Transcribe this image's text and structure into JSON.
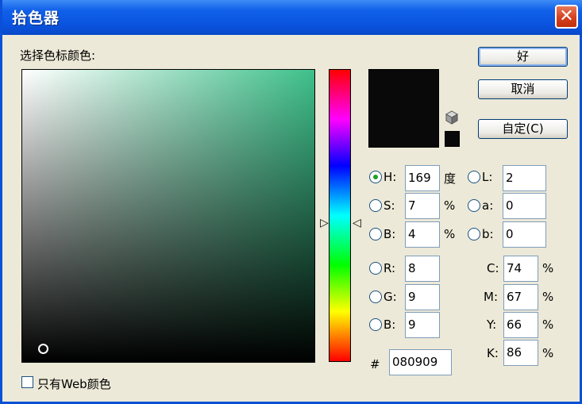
{
  "window": {
    "title": "拾色器",
    "close_glyph": "✕"
  },
  "picker": {
    "label": "选择色标颜色:"
  },
  "current_color": "#090909",
  "hue_color": "#3ec08a",
  "buttons": {
    "ok": "好",
    "cancel": "取消",
    "custom": "自定(C)"
  },
  "hsb": {
    "h": {
      "label": "H:",
      "value": "169",
      "unit": "度"
    },
    "s": {
      "label": "S:",
      "value": "7",
      "unit": "%"
    },
    "b": {
      "label": "B:",
      "value": "4",
      "unit": "%"
    }
  },
  "lab": {
    "l": {
      "label": "L:",
      "value": "2"
    },
    "a": {
      "label": "a:",
      "value": "0"
    },
    "b": {
      "label": "b:",
      "value": "0"
    }
  },
  "rgb": {
    "r": {
      "label": "R:",
      "value": "8"
    },
    "g": {
      "label": "G:",
      "value": "9"
    },
    "b": {
      "label": "B:",
      "value": "9"
    }
  },
  "cmyk": {
    "c": {
      "label": "C:",
      "value": "74",
      "unit": "%"
    },
    "m": {
      "label": "M:",
      "value": "67",
      "unit": "%"
    },
    "y": {
      "label": "Y:",
      "value": "66",
      "unit": "%"
    },
    "k": {
      "label": "K:",
      "value": "86",
      "unit": "%"
    }
  },
  "hex": {
    "label": "#",
    "value": "080909"
  },
  "web_only": {
    "label": "只有Web颜色",
    "checked": false
  },
  "icons": {
    "cube": "gamut-cube-icon",
    "selected_radio": "hsb-h"
  }
}
